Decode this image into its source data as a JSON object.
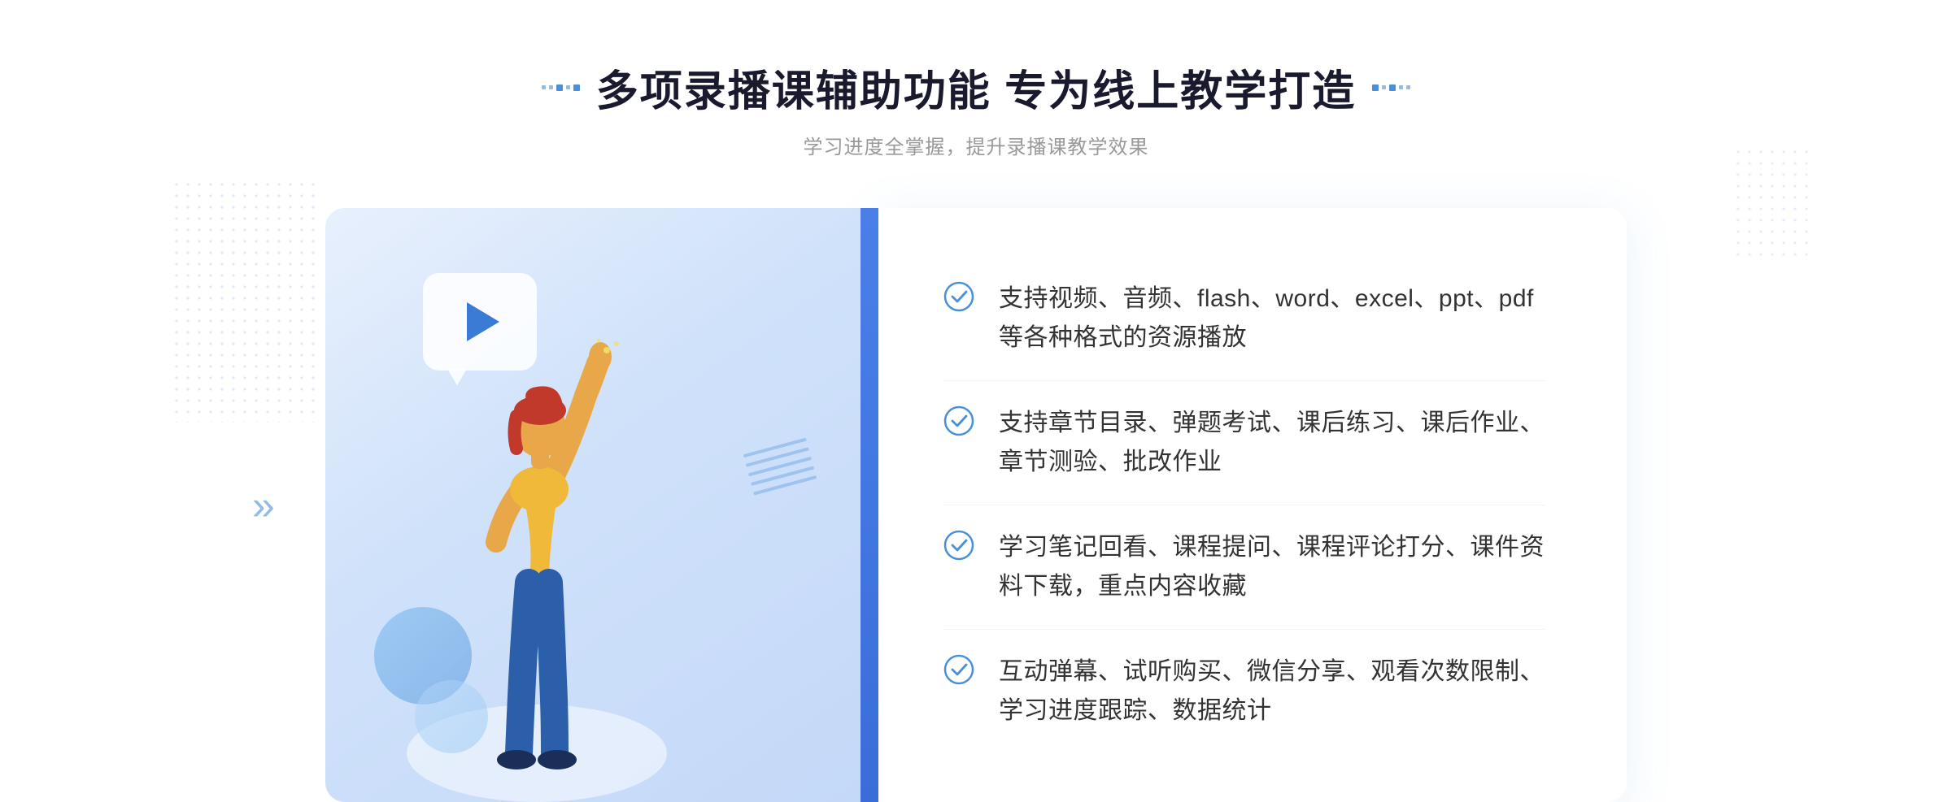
{
  "page": {
    "title": "多项录播课辅助功能 专为线上教学打造",
    "subtitle": "学习进度全掌握，提升录播课教学效果",
    "features": [
      {
        "id": "feature-1",
        "text": "支持视频、音频、flash、word、excel、ppt、pdf等各种格式的资源播放"
      },
      {
        "id": "feature-2",
        "text": "支持章节目录、弹题考试、课后练习、课后作业、章节测验、批改作业"
      },
      {
        "id": "feature-3",
        "text": "学习笔记回看、课程提问、课程评论打分、课件资料下载，重点内容收藏"
      },
      {
        "id": "feature-4",
        "text": "互动弹幕、试听购买、微信分享、观看次数限制、学习进度跟踪、数据统计"
      }
    ],
    "colors": {
      "accent": "#4a90d9",
      "title": "#1a1a2e",
      "text": "#333333",
      "subtitle": "#999999",
      "check": "#4a90d9"
    }
  }
}
